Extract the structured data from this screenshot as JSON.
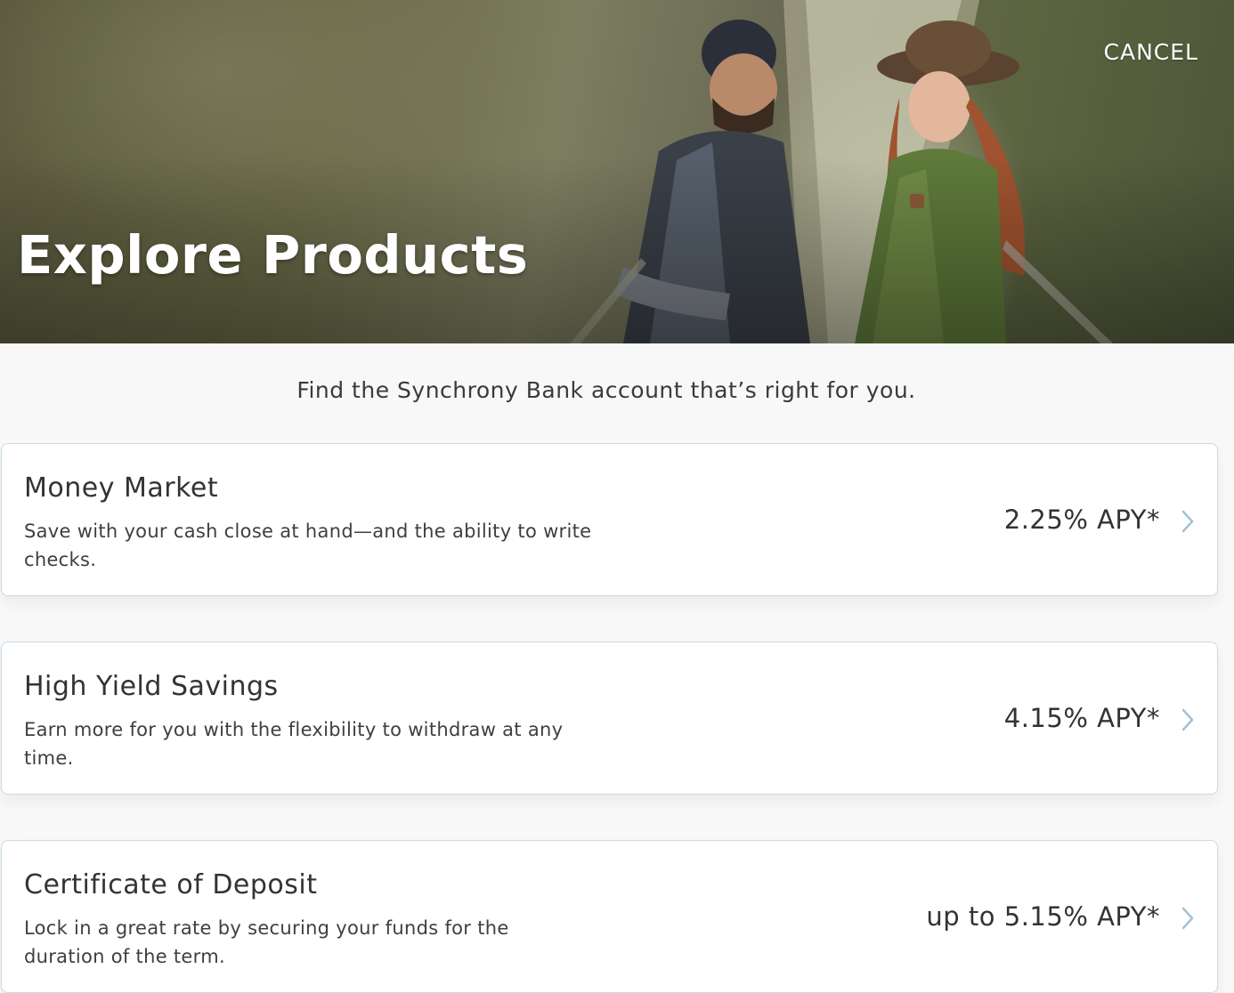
{
  "header": {
    "title": "Explore Products",
    "cancel_label": "CANCEL"
  },
  "intro_text": "Find the Synchrony Bank account that’s right for you.",
  "products": [
    {
      "name": "Money Market",
      "description": "Save with your cash close at hand—and the ability to write checks.",
      "rate": "2.25% APY*"
    },
    {
      "name": "High Yield Savings",
      "description": "Earn more for you with the flexibility to withdraw at any time.",
      "rate": "4.15% APY*"
    },
    {
      "name": "Certificate of Deposit",
      "description": "Lock in a great rate by securing your funds for the duration of the term.",
      "rate": "up to 5.15% APY*"
    }
  ],
  "colors": {
    "card_border": "#c7dbe6",
    "chevron": "#9fc3d8",
    "page_background": "#f8f8f8"
  }
}
